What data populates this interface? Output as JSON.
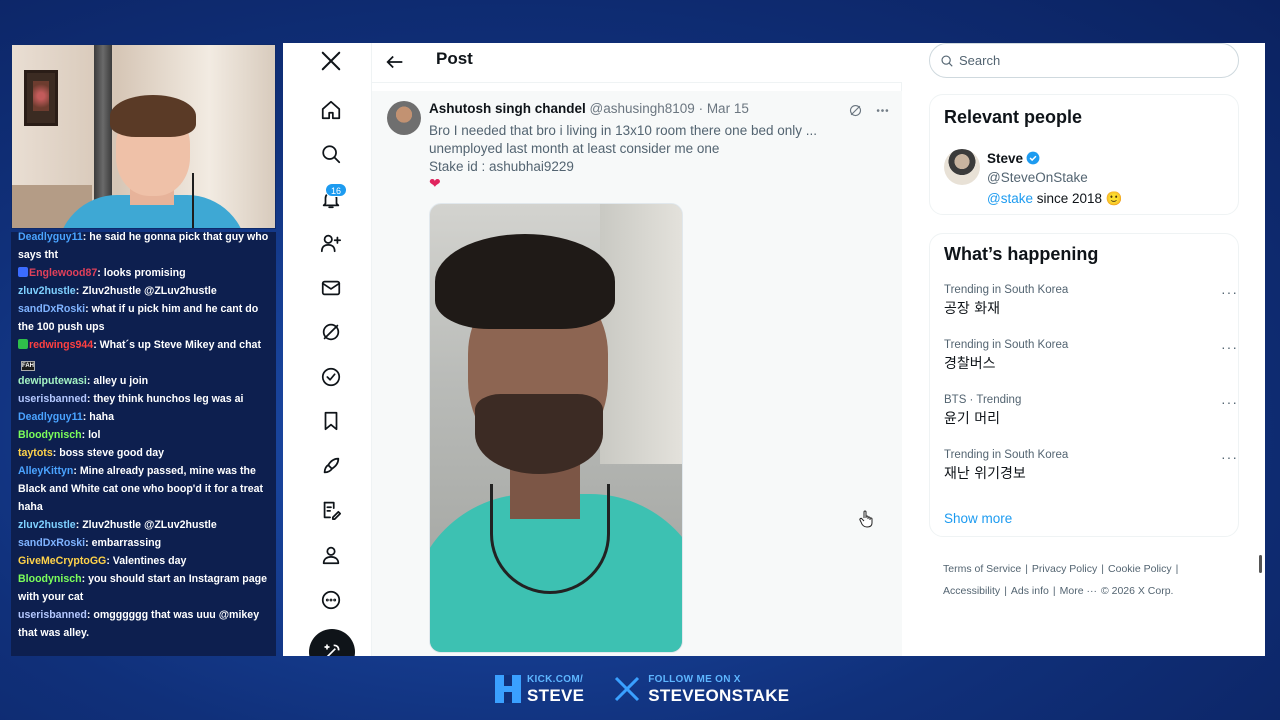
{
  "chat": [
    {
      "user": "Deadlyguy11",
      "user_color": "#4aa3ff",
      "message": "he said he gonna pick that guy who says tht"
    },
    {
      "user": "Englewood87",
      "user_color": "#e0405a",
      "badge": "#3b6cff",
      "message": "looks promising"
    },
    {
      "user": "zluv2hustle",
      "user_color": "#7fd1ff",
      "message": "Zluv2hustle @ZLuv2hustle"
    },
    {
      "user": "sandDxRoski",
      "user_color": "#7fb3ff",
      "message": "what if u pick him and he cant do the 100 push ups"
    },
    {
      "user": "redwings944",
      "user_color": "#ff4040",
      "badge": "#2fbf4a",
      "message": "What´s up Steve Mikey and chat",
      "emote": "FAH"
    },
    {
      "user": "dewiputewasi",
      "user_color": "#a4f2c3",
      "message": "alley u join"
    },
    {
      "user": "userisbanned",
      "user_color": "#b4c8ff",
      "message": "they think hunchos leg was ai"
    },
    {
      "user": "Deadlyguy11",
      "user_color": "#4aa3ff",
      "message": "haha"
    },
    {
      "user": "Bloodynisch",
      "user_color": "#7cff5a",
      "message": "lol"
    },
    {
      "user": "taytots",
      "user_color": "#ffd34a",
      "message": "boss steve good day"
    },
    {
      "user": "AlleyKittyn",
      "user_color": "#4aa3ff",
      "message": "Mine already passed, mine was the Black and White cat one who boop'd it for a treat haha"
    },
    {
      "user": "zluv2hustle",
      "user_color": "#7fd1ff",
      "message": "Zluv2hustle @ZLuv2hustle"
    },
    {
      "user": "sandDxRoski",
      "user_color": "#7fb3ff",
      "message": "embarrassing"
    },
    {
      "user": "GiveMeCryptoGG",
      "user_color": "#ffd34a",
      "message": "Valentines day"
    },
    {
      "user": "Bloodynisch",
      "user_color": "#7cff5a",
      "message": "you should start an Instagram page with your cat"
    },
    {
      "user": "userisbanned",
      "user_color": "#b4c8ff",
      "message": "omgggggg that was uuu @mikey that was alley."
    }
  ],
  "nav": {
    "notif_count": "16"
  },
  "header": {
    "title": "Post"
  },
  "tweet": {
    "name": "Ashutosh singh chandel",
    "handle": "@ashusingh8109 · Mar 15",
    "body": "Bro I needed that bro i living in 13x10 room there one bed only ...\nunemployed last month at least consider me one\nStake id : ashubhai9229",
    "heart": "❤"
  },
  "search": {
    "placeholder": "Search"
  },
  "relevant": {
    "title": "Relevant people",
    "name": "Steve",
    "handle": "@SteveOnStake",
    "bio_mention": "@stake",
    "bio_rest": " since 2018 🙂"
  },
  "happening": {
    "title": "What’s happening",
    "trends": [
      {
        "meta": "Trending in South Korea",
        "name": "공장 화재"
      },
      {
        "meta": "Trending in South Korea",
        "name": "경찰버스"
      },
      {
        "meta": "BTS · Trending",
        "name": "윤기 머리"
      },
      {
        "meta": "Trending in South Korea",
        "name": "재난 위기경보"
      }
    ],
    "more_icon": "···",
    "show_more": "Show more"
  },
  "footer": {
    "links": [
      "Terms of Service",
      "|",
      "Privacy Policy",
      "|",
      "Cookie Policy",
      "|",
      "Accessibility",
      "|",
      "Ads info",
      "|",
      "More ···",
      "© 2026 X Corp."
    ]
  },
  "banner": {
    "kick_small": "KICK.COM/",
    "kick_big": "STEVE",
    "x_small": "FOLLOW ME ON X",
    "x_big": "STEVEONSTAKE"
  },
  "colors": {
    "accent": "#1d9bf0",
    "background": "#10307a"
  }
}
